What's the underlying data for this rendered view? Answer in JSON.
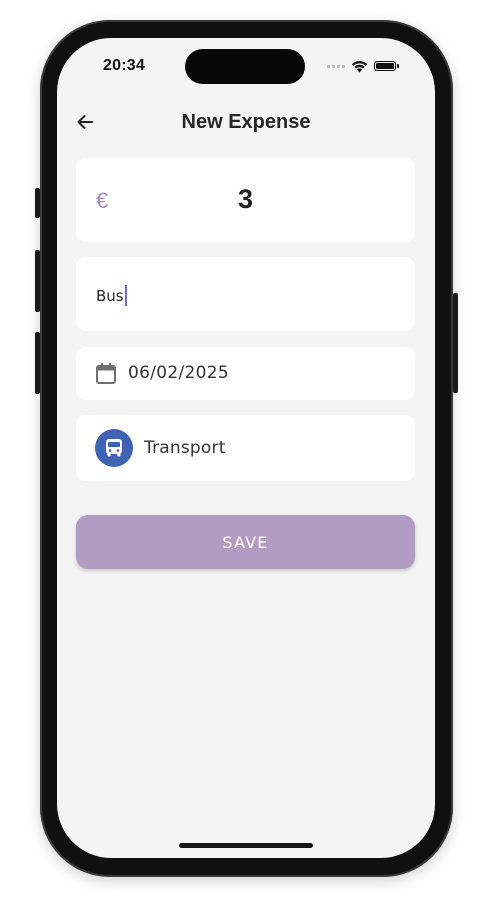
{
  "status_bar": {
    "time": "20:34"
  },
  "header": {
    "title": "New Expense"
  },
  "amount": {
    "currency_symbol": "€",
    "value": "3"
  },
  "description": {
    "value": "Bus"
  },
  "date": {
    "value": "06/02/2025"
  },
  "category": {
    "label": "Transport"
  },
  "actions": {
    "save_label": "SAVE"
  },
  "icons": {
    "back": "arrow-left-icon",
    "calendar": "calendar-icon",
    "category": "bus-icon",
    "wifi": "wifi-icon",
    "battery": "battery-icon",
    "signal": "cellular-signal-icon"
  },
  "colors": {
    "accent": "#b39cc3",
    "currency": "#a58cc0",
    "category_badge": "#3f62b3",
    "caret": "#7e6ab3"
  }
}
